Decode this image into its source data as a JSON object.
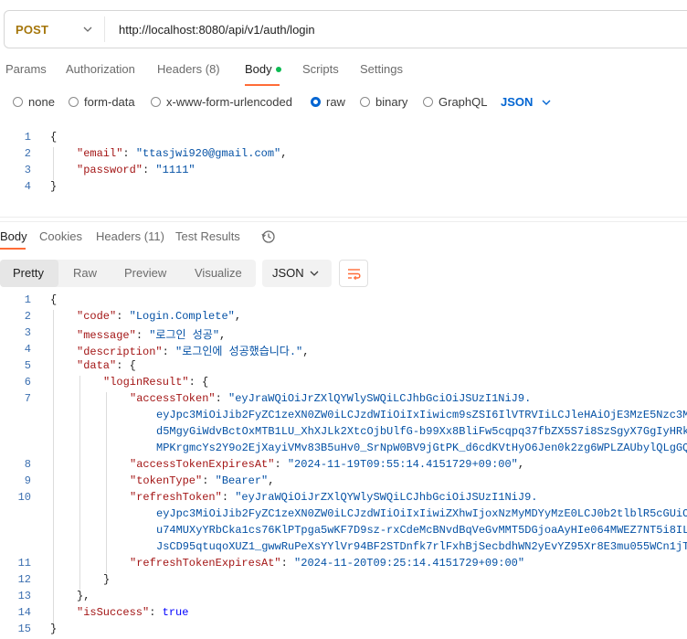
{
  "request": {
    "method": "POST",
    "url": "http://localhost:8080/api/v1/auth/login",
    "tabs": [
      "Params",
      "Authorization",
      "Headers (8)",
      "Body",
      "Scripts",
      "Settings"
    ],
    "body_modes": [
      "none",
      "form-data",
      "x-www-form-urlencoded",
      "raw",
      "binary",
      "GraphQL"
    ],
    "selected_mode": "raw",
    "body_type": "JSON",
    "body_lines": {
      "l1": "{",
      "l2_key": "\"email\"",
      "l2_val": "\"ttasjwi920@gmail.com\"",
      "l3_key": "\"password\"",
      "l3_val": "\"1111\"",
      "l4": "}"
    }
  },
  "response": {
    "tabs": [
      "Body",
      "Cookies",
      "Headers",
      "Test Results"
    ],
    "headers_count": "(11)",
    "views": [
      "Pretty",
      "Raw",
      "Preview",
      "Visualize"
    ],
    "format": "JSON",
    "lines": {
      "code_key": "\"code\"",
      "code_val": "\"Login.Complete\"",
      "message_key": "\"message\"",
      "message_val": "\"로그인 성공\"",
      "description_key": "\"description\"",
      "description_val": "\"로그인에 성공했습니다.\"",
      "data_key": "\"data\"",
      "loginResult_key": "\"loginResult\"",
      "accessToken_key": "\"accessToken\"",
      "accessToken_l1": "\"eyJraWQiOiJrZXlQYWlySWQiLCJhbGciOiJSUzI1NiJ9.",
      "accessToken_l2": "eyJpc3MiOiJib2FyZC1zeXN0ZW0iLCJzdWIiOiIxIiwicm9sZSI6IlVTRVIiLCJleHAiOjE3MzE5Nzc3M",
      "accessToken_l3": "d5MgyGiWdvBctOxMTB1LU_XhXJLk2XtcOjbUlfG-b99Xx8BliFw5cqpq37fbZX5S7i8SzSgyX7GgIyHRk",
      "accessToken_l4": "MPKrgmcYs2Y9o2EjXayiVMv83B5uHv0_SrNpW0BV9jGtPK_d6cdKVtHyO6Jen0k2zg6WPLZAUbylQLgGQ",
      "accessTokenExpiresAt_key": "\"accessTokenExpiresAt\"",
      "accessTokenExpiresAt_val": "\"2024-11-19T09:55:14.4151729+09:00\"",
      "tokenType_key": "\"tokenType\"",
      "tokenType_val": "\"Bearer\"",
      "refreshToken_key": "\"refreshToken\"",
      "refreshToken_l1": "\"eyJraWQiOiJrZXlQYWlySWQiLCJhbGciOiJSUzI1NiJ9.",
      "refreshToken_l2": "eyJpc3MiOiJib2FyZC1zeXN0ZW0iLCJzdWIiOiIxIiwiZXhwIjoxNzMyMDYyMzE0LCJ0b2tlblR5cGUiO",
      "refreshToken_l3": "u74MUXyYRbCka1cs76KlPTpga5wKF7D9sz-rxCdeMcBNvdBqVeGvMMT5DGjoaAyHIe064MWEZ7NT5i8IL",
      "refreshToken_l4": "JsCD95qtuqoXUZ1_gwwRuPeXsYYlVr94BF2STDnfk7rlFxhBjSecbdhWN2yEvYZ95Xr8E3mu055WCn1jT",
      "refreshTokenExpiresAt_key": "\"refreshTokenExpiresAt\"",
      "refreshTokenExpiresAt_val": "\"2024-11-20T09:25:14.4151729+09:00\"",
      "isSuccess_key": "\"isSuccess\"",
      "isSuccess_val": "true"
    }
  }
}
